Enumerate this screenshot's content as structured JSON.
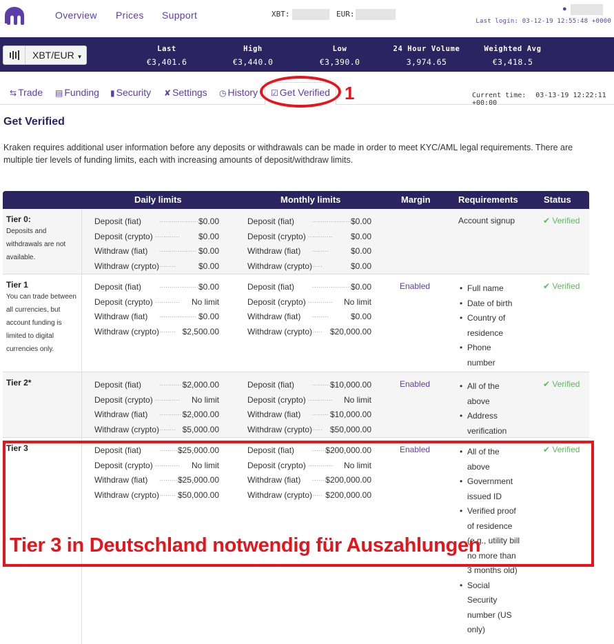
{
  "nav": {
    "links": [
      "Overview",
      "Prices",
      "Support"
    ],
    "balance_xbt_label": "XBT:",
    "balance_eur_label": "EUR:",
    "last_login": "Last login: 03-12-19 12:55:48 +0000"
  },
  "ticker": {
    "pair": "XBT/EUR",
    "stats": [
      {
        "label": "Last",
        "value": "€3,401.6"
      },
      {
        "label": "High",
        "value": "€3,440.0"
      },
      {
        "label": "Low",
        "value": "€3,390.0"
      },
      {
        "label": "24 Hour Volume",
        "value": "3,974.65"
      },
      {
        "label": "Weighted Avg",
        "value": "€3,418.5"
      }
    ]
  },
  "tabs": [
    {
      "label": "Trade",
      "icon": "exchange-icon"
    },
    {
      "label": "Funding",
      "icon": "money-icon"
    },
    {
      "label": "Security",
      "icon": "lock-icon"
    },
    {
      "label": "Settings",
      "icon": "wrench-icon"
    },
    {
      "label": "History",
      "icon": "clock-icon"
    },
    {
      "label": "Get Verified",
      "icon": "check-square-icon"
    }
  ],
  "current_time": {
    "label": "Current time:",
    "value": "03-13-19 12:22:11 +00:00"
  },
  "annotation": {
    "number": "1",
    "note": "Tier 3 in Deutschland notwendig für Auszahlungen",
    "color": "#e8141c"
  },
  "page": {
    "title": "Get Verified",
    "intro": "Kraken requires additional user information before any deposits or withdrawals can be made in order to meet KYC/AML legal requirements. There are multiple tier levels of funding limits, each with increasing amounts of deposit/withdraw limits."
  },
  "table": {
    "headers": {
      "daily": "Daily limits",
      "monthly": "Monthly limits",
      "margin": "Margin",
      "requirements": "Requirements",
      "status": "Status"
    },
    "limit_labels": [
      "Deposit (fiat)",
      "Deposit (crypto)",
      "Withdraw (fiat)",
      "Withdraw (crypto)"
    ],
    "tiers": [
      {
        "name": "Tier 0:",
        "desc": "Deposits and withdrawals are not available.",
        "daily": [
          "$0.00",
          "$0.00",
          "$0.00",
          "$0.00"
        ],
        "monthly": [
          "$0.00",
          "$0.00",
          "$0.00",
          "$0.00"
        ],
        "margin": "",
        "requirements": [
          "Account signup"
        ],
        "status": "Verified"
      },
      {
        "name": "Tier 1",
        "desc": "You can trade between all currencies, but account funding is limited to digital currencies only.",
        "daily": [
          "$0.00",
          "No limit",
          "$0.00",
          "$2,500.00"
        ],
        "monthly": [
          "$0.00",
          "No limit",
          "$0.00",
          "$20,000.00"
        ],
        "margin": "Enabled",
        "requirements": [
          "Full name",
          "Date of birth",
          "Country of residence",
          "Phone number"
        ],
        "status": "Verified"
      },
      {
        "name": "Tier 2*",
        "desc": "",
        "daily": [
          "$2,000.00",
          "No limit",
          "$2,000.00",
          "$5,000.00"
        ],
        "monthly": [
          "$10,000.00",
          "No limit",
          "$10,000.00",
          "$50,000.00"
        ],
        "margin": "Enabled",
        "requirements": [
          "All of the above",
          "Address verification"
        ],
        "status": "Verified"
      },
      {
        "name": "Tier 3",
        "desc": "",
        "daily": [
          "$25,000.00",
          "No limit",
          "$25,000.00",
          "$50,000.00"
        ],
        "monthly": [
          "$200,000.00",
          "No limit",
          "$200,000.00",
          "$200,000.00"
        ],
        "margin": "Enabled",
        "requirements": [
          "All of the above",
          "Government issued ID",
          "Verified proof of residence (e.g., utility bill no more than 3 months old)",
          "Social Security number (US only)"
        ],
        "status": "Verified"
      }
    ]
  }
}
